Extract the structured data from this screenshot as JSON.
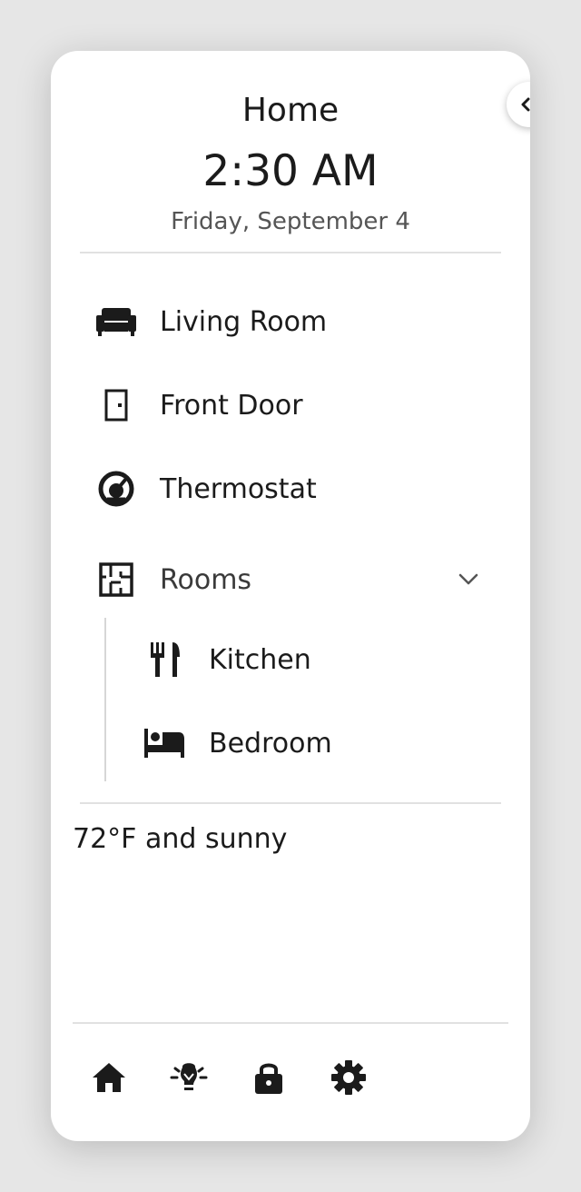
{
  "header": {
    "title": "Home",
    "time": "2:30 AM",
    "date": "Friday, September 4"
  },
  "nav": {
    "items": [
      {
        "label": "Living Room",
        "icon": "sofa-icon"
      },
      {
        "label": "Front Door",
        "icon": "door-icon"
      },
      {
        "label": "Thermostat",
        "icon": "thermostat-icon"
      }
    ],
    "rooms": {
      "label": "Rooms",
      "icon": "floor-plan-icon",
      "expanded": true,
      "children": [
        {
          "label": "Kitchen",
          "icon": "fork-knife-icon"
        },
        {
          "label": "Bedroom",
          "icon": "bed-icon"
        }
      ]
    }
  },
  "status": {
    "weather": "72°F and sunny"
  },
  "footer": {
    "icons": [
      "home-icon",
      "lightbulb-icon",
      "lock-icon",
      "gear-icon"
    ]
  },
  "colors": {
    "panel_bg": "#ffffff",
    "page_bg": "#e6e6e6",
    "text": "#1b1b1b",
    "muted_text": "#555555",
    "divider": "#e1e1e1"
  }
}
